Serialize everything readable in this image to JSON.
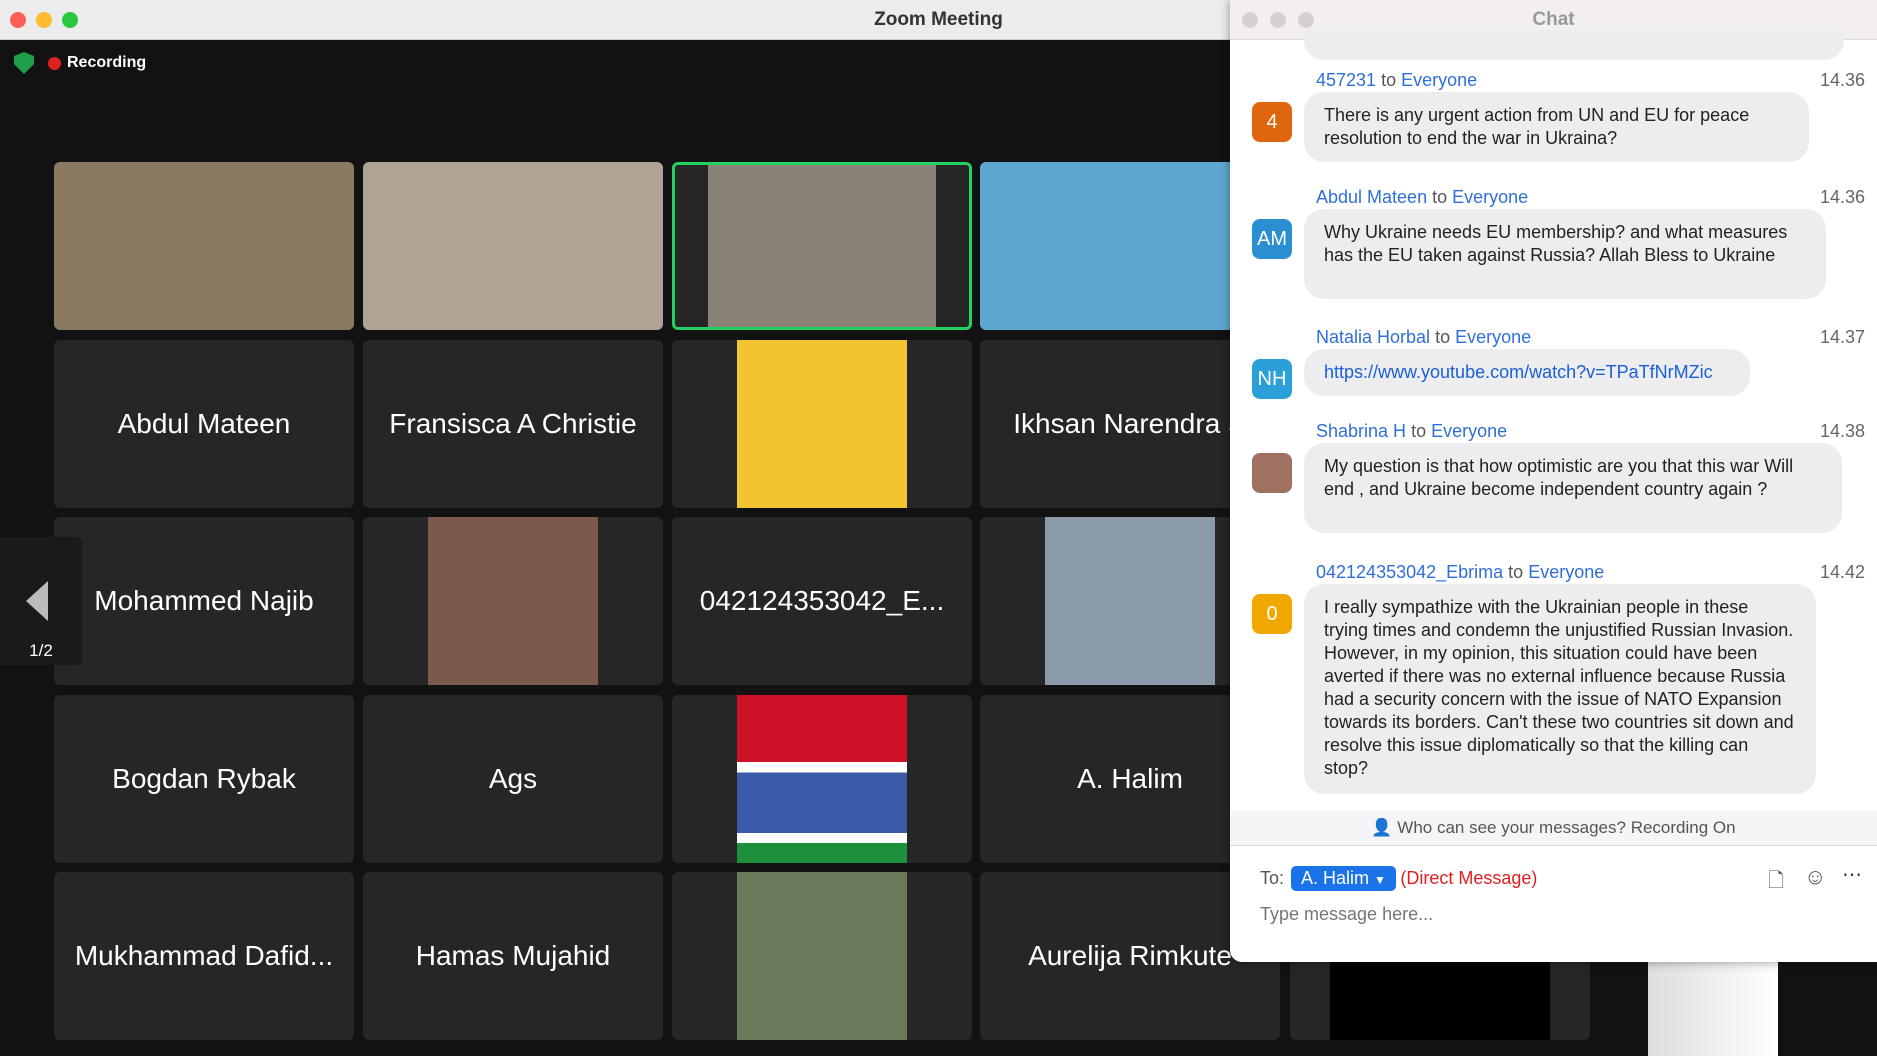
{
  "window": {
    "title": "Zoom Meeting"
  },
  "status": {
    "recording": "Recording"
  },
  "pager": {
    "page": "1/2"
  },
  "tiles": [
    {
      "name": "",
      "type": "video",
      "color": "#8a7a62"
    },
    {
      "name": "",
      "type": "video",
      "color": "#b0a395"
    },
    {
      "name": "",
      "type": "video",
      "color": "#8a8276",
      "active": true
    },
    {
      "name": "",
      "type": "video",
      "color": "#5fa6d0"
    },
    {
      "name": "Abdul Mateen",
      "type": "name"
    },
    {
      "name": "Fransisca A Christie",
      "type": "name"
    },
    {
      "name": "",
      "type": "image",
      "color": "#f0c530"
    },
    {
      "name": "Ikhsan Narendra S",
      "type": "name"
    },
    {
      "name": "Mohammed Najib",
      "type": "name"
    },
    {
      "name": "",
      "type": "image",
      "color": "#7a5a4a"
    },
    {
      "name": "042124353042_E...",
      "type": "name"
    },
    {
      "name": "",
      "type": "image",
      "color": "#8a9aa8"
    },
    {
      "name": "Bogdan Rybak",
      "type": "name"
    },
    {
      "name": "Ags",
      "type": "name"
    },
    {
      "name": "",
      "type": "flag"
    },
    {
      "name": "A. Halim",
      "type": "name"
    },
    {
      "name": "Mukhammad Dafid...",
      "type": "name"
    },
    {
      "name": "Hamas Mujahid",
      "type": "name"
    },
    {
      "name": "",
      "type": "image",
      "color": "#6a7a5a"
    },
    {
      "name": "Aurelija Rimkute",
      "type": "name"
    }
  ],
  "chat": {
    "title": "Chat",
    "messages": [
      {
        "sender": "457231",
        "to": "to",
        "recipient": "Everyone",
        "time": "14.36",
        "avatar": "4",
        "avatar_color": "#e0650f",
        "text": "There is any urgent action from UN and EU for peace resolution to end the war in Ukraina?"
      },
      {
        "sender": "Abdul Mateen",
        "to": "to",
        "recipient": "Everyone",
        "time": "14.36",
        "avatar": "AM",
        "avatar_color": "#2a8fd0",
        "text": "Why Ukraine needs EU membership? and what measures has the EU taken against Russia? Allah Bless to Ukraine"
      },
      {
        "sender": "Natalia Horbal",
        "to": "to",
        "recipient": "Everyone",
        "time": "14.37",
        "avatar": "NH",
        "avatar_color": "#2a9fd8",
        "text": "https://www.youtube.com/watch?v=TPaTfNrMZic"
      },
      {
        "sender": "Shabrina H",
        "to": "to",
        "recipient": "Everyone",
        "time": "14.38",
        "avatar": "",
        "avatar_color": "#a07060",
        "text": "My question is that how optimistic are you that this war Will end , and Ukraine become independent country again ?"
      },
      {
        "sender": "042124353042_Ebrima",
        "to": "to",
        "recipient": "Everyone",
        "time": "14.42",
        "avatar": "0",
        "avatar_color": "#f0a800",
        "text": "I really sympathize with the Ukrainian people in these trying times and condemn the unjustified Russian Invasion. However, in my opinion, this situation could have been averted if there was no external influence because Russia had a security concern with the issue of NATO Expansion towards its borders. Can't these two countries sit down and resolve this issue diplomatically so that the killing can stop?"
      }
    ],
    "notice": "Who can see your messages? Recording On",
    "to_label": "To:",
    "recipient": "A. Halim",
    "direct": "(Direct Message)",
    "placeholder": "Type message here..."
  }
}
